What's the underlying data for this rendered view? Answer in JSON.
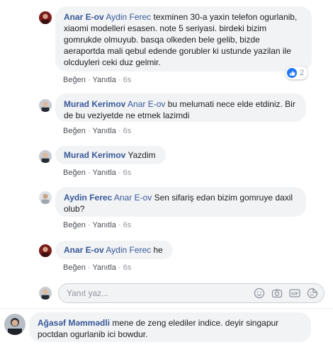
{
  "comments": [
    {
      "author": "Anar E-ov",
      "mention": "Aydin Ferec",
      "text": " texminen 30-a yaxin telefon ogurlanib, xiaomi modelleri esasen. note 5 seriyasi. birdeki bizim gomrukde olmuyub. basqa olkeden bele gelib, bizde aeraportda mali qebul edende gorubler ki ustunde yazilan ile olcduyleri ceki duz gelmir.",
      "like": "Beğen",
      "reply": "Yanıtla",
      "time": "6s",
      "reaction_count": "2"
    },
    {
      "author": "Murad Kerimov",
      "mention": "Anar E-ov",
      "text": " bu melumati nece elde etdiniz. Bir de bu veziyetde ne etmek lazimdi",
      "like": "Beğen",
      "reply": "Yanıtla",
      "time": "6s"
    },
    {
      "author": "Murad Kerimov",
      "mention": "",
      "text": " Yazdim",
      "like": "Beğen",
      "reply": "Yanıtla",
      "time": "6s"
    },
    {
      "author": "Aydin Ferec",
      "mention": "Anar E-ov",
      "text": " Sen sifariş edən bizim gomruye daxil olub?",
      "like": "Beğen",
      "reply": "Yanıtla",
      "time": "6s"
    },
    {
      "author": "Anar E-ov",
      "mention": "Aydin Ferec",
      "text": " he",
      "like": "Beğen",
      "reply": "Yanıtla",
      "time": "6s"
    }
  ],
  "reply_input": {
    "placeholder": "Yanıt yaz..."
  },
  "bottom_comment": {
    "author": "Ağasəf Məmmədli",
    "text": " mene de zeng elediler indice. deyir singapur poctdan ogurlanib ici bowdur."
  },
  "colors": {
    "author": "#385898",
    "bubble": "#f2f3f5",
    "meta": "#90949c",
    "like_badge": "#2078f4"
  },
  "icons": [
    "emoji-icon",
    "camera-icon",
    "gif-icon",
    "sticker-icon"
  ]
}
